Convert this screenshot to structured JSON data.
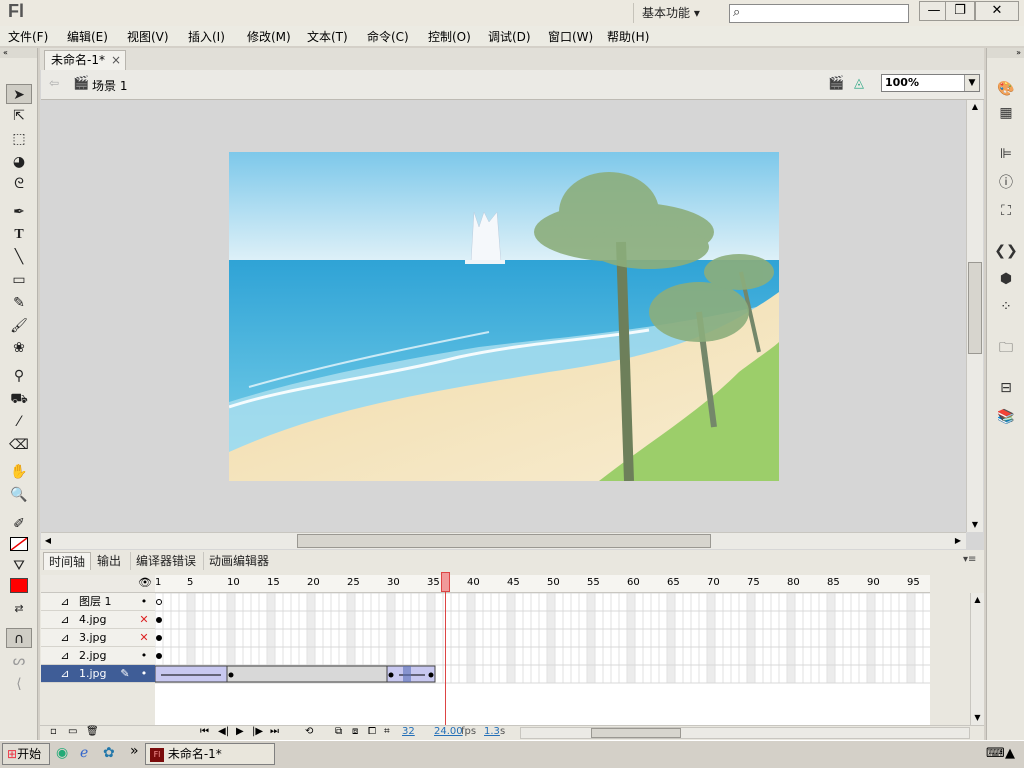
{
  "app": {
    "logo": "Fl",
    "workspace": "基本功能",
    "workspace_arrow": "▾"
  },
  "window_buttons": {
    "minimize": "—",
    "restore": "❐",
    "close": "✕"
  },
  "menus": [
    "文件(F)",
    "编辑(E)",
    "视图(V)",
    "插入(I)",
    "修改(M)",
    "文本(T)",
    "命令(C)",
    "控制(O)",
    "调试(D)",
    "窗口(W)",
    "帮助(H)"
  ],
  "document": {
    "tab_title": "未命名-1*",
    "tab_close": "×",
    "scene_name": "场景 1",
    "zoom": "100%"
  },
  "timeline": {
    "tabs": [
      "时间轴",
      "输出",
      "编译器错误",
      "动画编辑器"
    ],
    "ruler_labels": [
      "1",
      "5",
      "10",
      "15",
      "20",
      "25",
      "30",
      "35",
      "40",
      "45",
      "50",
      "55",
      "60",
      "65",
      "70",
      "75",
      "80",
      "85",
      "90",
      "95"
    ],
    "layers": [
      {
        "name": "图层 1",
        "visible": "•",
        "lock": "•",
        "color": "#3ec83e",
        "selected": false
      },
      {
        "name": "4.jpg",
        "visible": "✕",
        "lock": "•",
        "color": "#6f6f6f",
        "selected": false
      },
      {
        "name": "3.jpg",
        "visible": "✕",
        "lock": "•",
        "color": "#3c6fe0",
        "selected": false
      },
      {
        "name": "2.jpg",
        "visible": "•",
        "lock": "•",
        "color": "#e84848",
        "selected": false
      },
      {
        "name": "1.jpg",
        "visible": "•",
        "lock": "•",
        "color": "#3ec83e",
        "selected": true
      }
    ],
    "current_frame": "32",
    "fps": "24.00",
    "fps_unit": "fps",
    "time": "1.3",
    "time_unit": "s"
  },
  "taskbar": {
    "start": "开始",
    "task": "未命名-1*",
    "chevron": "»"
  },
  "colors": {
    "stroke": "#000000",
    "fill": "#ff0000",
    "playhead": "#e84848"
  }
}
